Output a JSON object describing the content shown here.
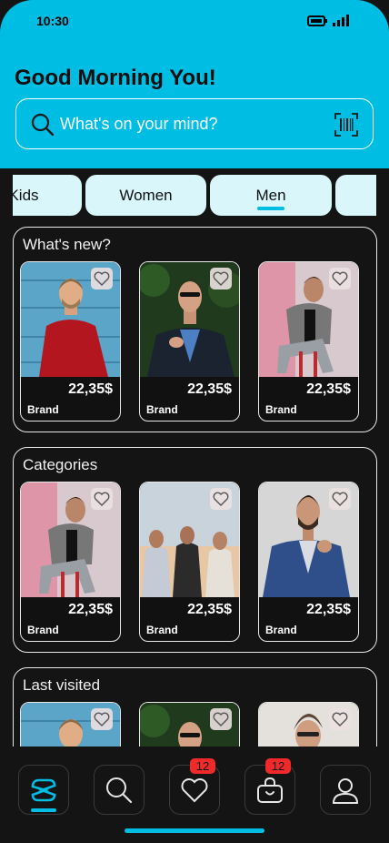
{
  "status_bar": {
    "time": "10:30"
  },
  "header": {
    "greeting": "Good Morning You!",
    "search": {
      "placeholder": "What's on your mind?",
      "value": ""
    }
  },
  "tabs": [
    {
      "label": "Kids",
      "active": false
    },
    {
      "label": "Women",
      "active": false
    },
    {
      "label": "Men",
      "active": true
    },
    {
      "label": "",
      "active": false
    }
  ],
  "sections": [
    {
      "title": "What's new?",
      "items": [
        {
          "price": "22,35$",
          "brand": "Brand"
        },
        {
          "price": "22,35$",
          "brand": "Brand"
        },
        {
          "price": "22,35$",
          "brand": "Brand"
        }
      ]
    },
    {
      "title": "Categories",
      "items": [
        {
          "price": "22,35$",
          "brand": "Brand"
        },
        {
          "price": "22,35$",
          "brand": "Brand"
        },
        {
          "price": "22,35$",
          "brand": "Brand"
        }
      ]
    },
    {
      "title": "Last visited",
      "items": [
        {
          "price": "",
          "brand": ""
        },
        {
          "price": "",
          "brand": ""
        },
        {
          "price": "",
          "brand": ""
        }
      ]
    }
  ],
  "bottom_nav": {
    "items": [
      {
        "icon": "logo-icon",
        "active": true
      },
      {
        "icon": "search-icon",
        "active": false
      },
      {
        "icon": "heart-icon",
        "badge": "12"
      },
      {
        "icon": "shopping-bag-icon",
        "badge": "12"
      },
      {
        "icon": "profile-icon",
        "active": false
      }
    ]
  },
  "colors": {
    "accent": "#00bde3",
    "background": "#141414",
    "tab_bg": "#d9f6fb",
    "badge": "#f02a2a"
  }
}
